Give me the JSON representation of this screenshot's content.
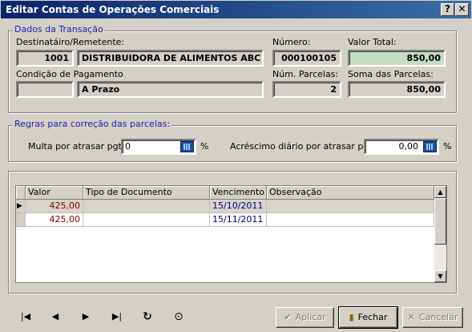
{
  "window": {
    "title": "Editar Contas de Operações Comerciais",
    "help_glyph": "?",
    "close_glyph": "✕"
  },
  "transaction": {
    "legend": "Dados da Transação",
    "dest_label": "Destinatáiro/Remetente:",
    "dest_code": "1001",
    "dest_name": "DISTRIBUIDORA DE ALIMENTOS ABC LTD.",
    "number_label": "Número:",
    "number_value": "000100105",
    "total_label": "Valor Total:",
    "total_value": "850,00",
    "payment_label": "Condição de Pagamento",
    "payment_code": "",
    "payment_name": "A Prazo",
    "installments_label": "Núm. Parcelas:",
    "installments_value": "2",
    "sum_label": "Soma das Parcelas:",
    "sum_value": "850,00"
  },
  "rules": {
    "legend": "Regras para correção das parcelas:",
    "late_fee_label": "Multa por atrasar pgto:",
    "late_fee_value": "0",
    "late_fee_unit": "%",
    "daily_label": "Acréscimo diário por atrasar pgto:",
    "daily_value": "0,00",
    "daily_unit": "%"
  },
  "grid": {
    "columns": [
      "Valor",
      "Tipo de Documento",
      "Vencimento",
      "Observação"
    ],
    "rows": [
      {
        "valor": "425,00",
        "tipo": "",
        "vencimento": "15/10/2011",
        "obs": ""
      },
      {
        "valor": "425,00",
        "tipo": "",
        "vencimento": "15/11/2011",
        "obs": ""
      }
    ],
    "row_indicator": "▶"
  },
  "nav": {
    "first": "|◀",
    "prev": "◀",
    "next": "▶",
    "last": "▶|",
    "refresh": "↻",
    "cancel": "⊙"
  },
  "buttons": {
    "apply": "Aplicar",
    "close": "Fechar",
    "cancel": "Cancelar"
  },
  "colors": {
    "title_start": "#0a246a",
    "legend": "#2020b0",
    "total_bg": "#c5dcc5",
    "value_text": "#800000",
    "date_text": "#000080"
  }
}
